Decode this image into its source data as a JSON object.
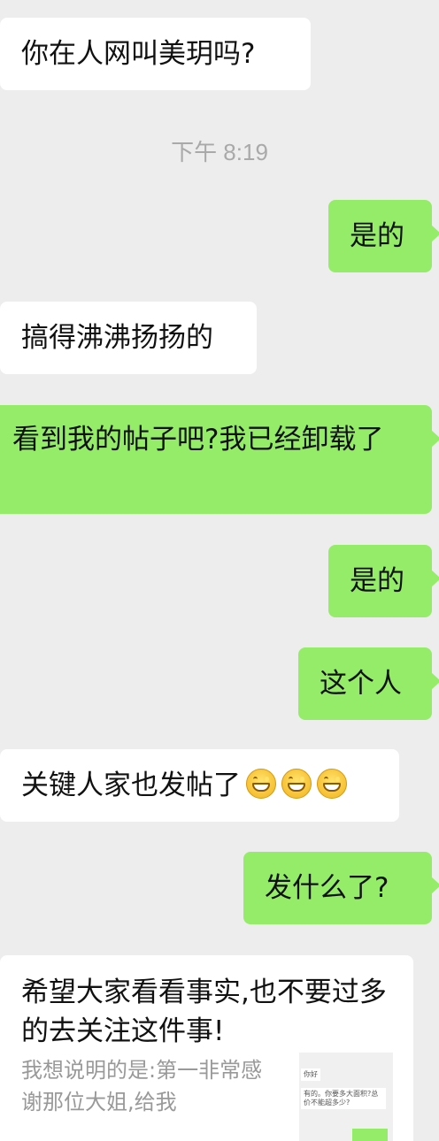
{
  "messages": [
    {
      "side": "left",
      "text": "你在人网叫美玥吗?"
    },
    {
      "side": "right",
      "text": "是的"
    },
    {
      "side": "left",
      "text": "搞得沸沸扬扬的"
    },
    {
      "side": "right",
      "text": "看到我的帖子吧?我已经卸载了"
    },
    {
      "side": "right",
      "text": "是的"
    },
    {
      "side": "right",
      "text": "这个人"
    },
    {
      "side": "left",
      "text": "关键人家也发帖了",
      "emojis": [
        "grin-icon",
        "grin-icon",
        "grin-icon"
      ]
    },
    {
      "side": "right",
      "text": "发什么了?"
    }
  ],
  "timestamp": "下午 8:19",
  "card": {
    "title": "希望大家看看事实,也不要过多的去关注这件事!",
    "description": "我想说明的是:第一非常感谢那位大姐,给我",
    "thumbnail": {
      "line1": "你好",
      "line2": "有的。你要多大面积?总价不能超多少?"
    }
  },
  "colors": {
    "left_bubble": "#ffffff",
    "right_bubble": "#95ec69",
    "background": "#ededed"
  }
}
